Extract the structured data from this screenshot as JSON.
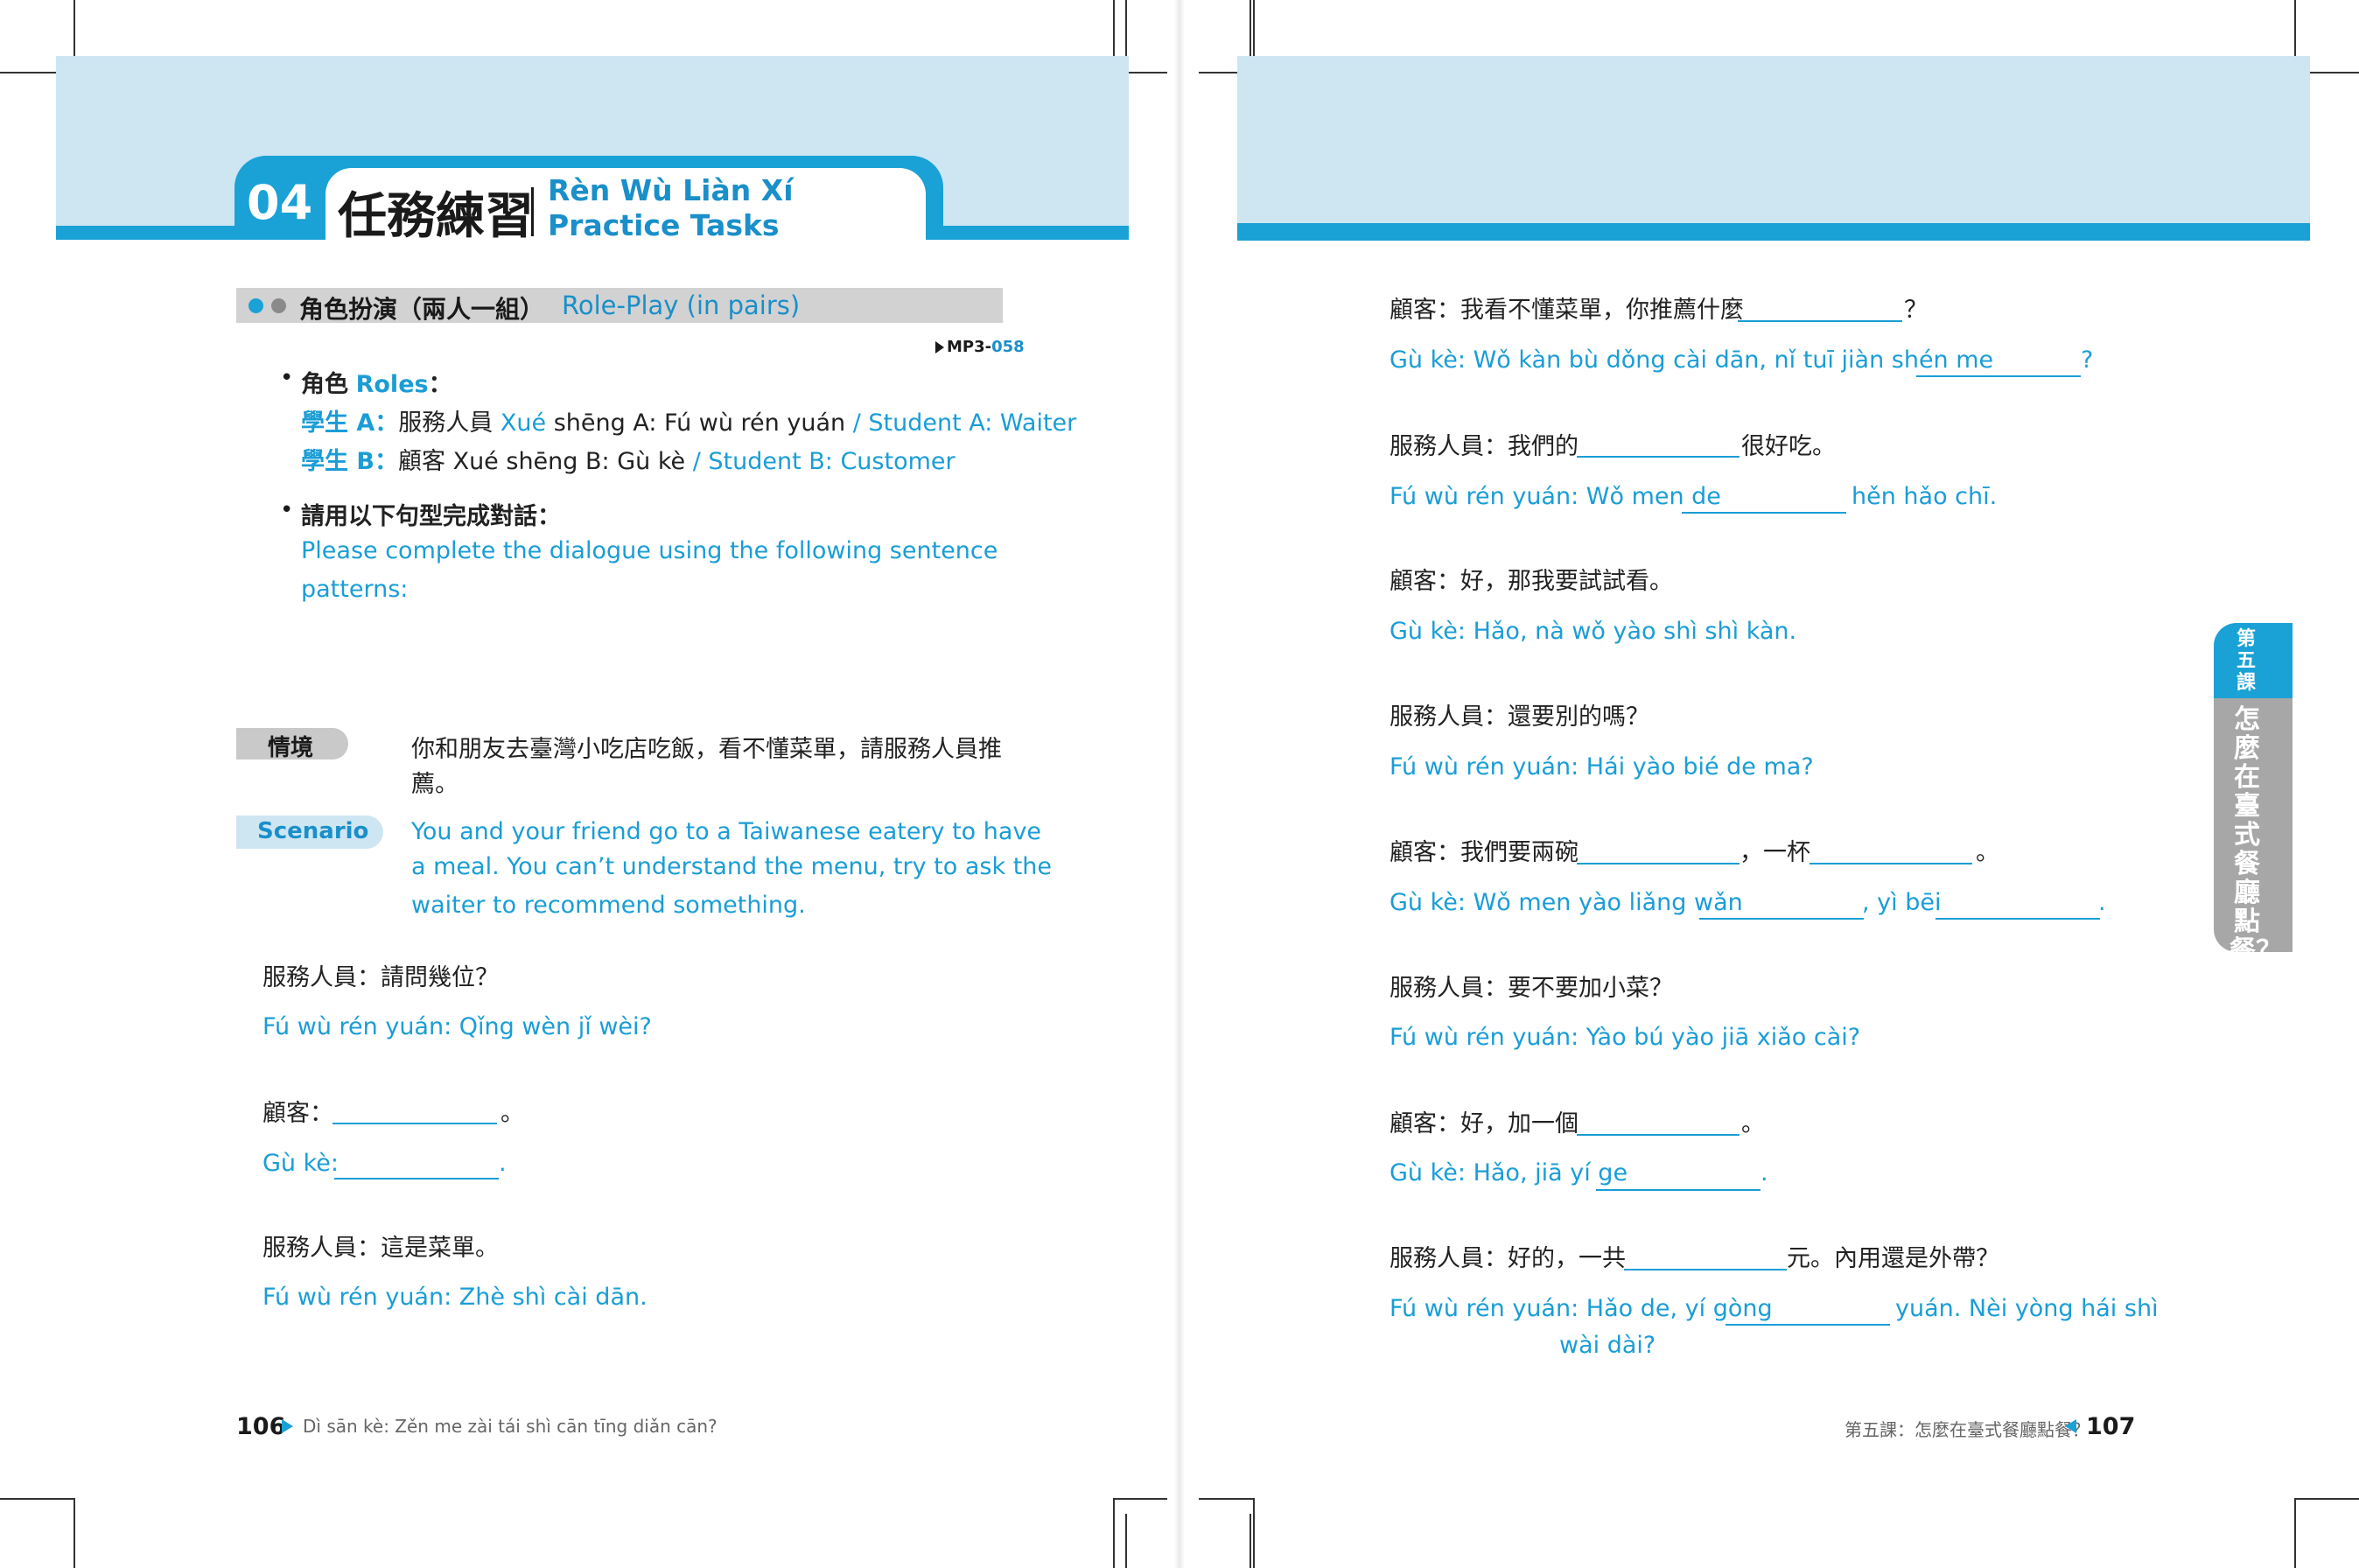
{
  "header": {
    "number": "04",
    "title_zh": "任務練習",
    "title_pinyin": "Rèn Wù Liàn Xí",
    "title_en": "Practice Tasks"
  },
  "roleplay": {
    "label_zh": "角色扮演（兩人一組）",
    "label_en": "Role-Play (in pairs)",
    "mp3_prefix": "MP3-",
    "mp3_number": "058"
  },
  "roles": {
    "heading_zh": "角色",
    "heading_en": "Roles",
    "heading_colon": "：",
    "student_a_label": "學生 A：",
    "student_a_zh": "服務人員",
    "student_a_pinyin_prefix": "Xué",
    "student_a_pinyin_rest": "shēng A: Fú wù rén yuán",
    "student_a_en": "/ Student A: Waiter",
    "student_b_label": "學生 B：",
    "student_b_zh": "顧客",
    "student_b_pinyin": "Xué shēng B: Gù kè",
    "student_b_en": "/ Student B: Customer"
  },
  "instructions": {
    "heading_zh": "請用以下句型完成對話：",
    "line1_en": "Please complete the dialogue using the following sentence",
    "line2_en": "patterns:"
  },
  "scenario": {
    "label_zh": "情境",
    "text_zh_line1": "你和朋友去臺灣小吃店吃飯，看不懂菜單，請服務人員推",
    "text_zh_line2": "薦。",
    "label_en": "Scenario",
    "text_en_line1": "You and your friend go to a Taiwanese eatery to have",
    "text_en_line2": "a meal. You can’t understand the menu, try to ask the",
    "text_en_line3": "waiter to recommend something."
  },
  "dialogue_left": [
    {
      "zh": "服務人員：請問幾位？",
      "pinyin": "Fú wù rén yuán: Qǐng wèn jǐ wèi?"
    },
    {
      "zh_before": "顧客：",
      "zh_after": "。",
      "pinyin_before": "Gù kè:",
      "pinyin_after": "."
    },
    {
      "zh": "服務人員：這是菜單。",
      "pinyin": "Fú wù rén yuán: Zhè shì cài dān."
    }
  ],
  "dialogue_right": {
    "l1_zh_before": "顧客：我看不懂菜單，你推薦什麼",
    "l1_zh_after": "？",
    "l1_py_before": "Gù kè: Wǒ kàn bù dǒng cài dān, nǐ tuī jiàn shén me",
    "l1_py_after": "?",
    "l2_zh_before": "服務人員：我們的",
    "l2_zh_after": "很好吃。",
    "l2_py_before": "Fú wù rén yuán: Wǒ men de",
    "l2_py_after": "hěn hǎo chī.",
    "l3_zh": "顧客：好，那我要試試看。",
    "l3_py": "Gù kè: Hǎo, nà wǒ yào shì shì kàn.",
    "l4_zh": "服務人員：還要別的嗎？",
    "l4_py": "Fú wù rén yuán: Hái yào bié de ma?",
    "l5_zh_before": "顧客：我們要兩碗",
    "l5_zh_mid": "，一杯",
    "l5_zh_after": "。",
    "l5_py_before": "Gù kè: Wǒ men yào liǎng wǎn",
    "l5_py_mid": ", yì bēi",
    "l5_py_after": ".",
    "l6_zh": "服務人員：要不要加小菜？",
    "l6_py": "Fú wù rén yuán: Yào bú yào jiā xiǎo cài?",
    "l7_zh_before": "顧客：好，加一個",
    "l7_zh_after": "。",
    "l7_py_before": "Gù kè: Hǎo, jiā yí ge",
    "l7_py_after": ".",
    "l8_zh_before": "服務人員：好的，一共",
    "l8_zh_after": "元。內用還是外帶？",
    "l8_py_before": "Fú wù rén yuán: Hǎo de, yí gòng",
    "l8_py_after": "yuán. Nèi yòng hái shì",
    "l8_py_line2": "wài dài?"
  },
  "footer": {
    "left_page": "106",
    "left_text": "Dì sān kè: Zěn me zài tái shì cān tīng diǎn cān?",
    "right_text": "第五課：怎麼在臺式餐廳點餐？",
    "right_page": "107"
  },
  "side_tab": {
    "lesson": "第五課",
    "title": "怎麼在臺式餐廳點餐？"
  },
  "colors": {
    "accent_blue": "#1aa1d6",
    "band_light_blue": "#cde6f2",
    "text_blue": "#1a9dd6",
    "gray_bar": "#d2d2d2"
  }
}
